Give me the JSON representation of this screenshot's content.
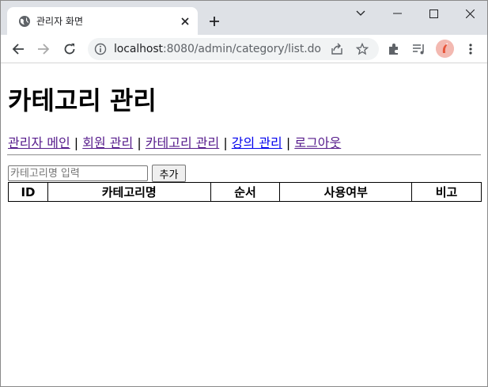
{
  "browser": {
    "tab_title": "관리자 화면",
    "url_host": "localhost",
    "url_rest": ":8080/admin/category/list.do"
  },
  "page": {
    "title": "카테고리 관리",
    "nav": [
      {
        "label": "관리자 메인"
      },
      {
        "label": "회원 관리"
      },
      {
        "label": "카테고리 관리"
      },
      {
        "label": "강의 관리"
      },
      {
        "label": "로그아웃"
      }
    ],
    "nav_separator": "|",
    "form": {
      "input_placeholder": "카테고리명 입력",
      "input_value": "",
      "add_button": "추가"
    },
    "table": {
      "columns": [
        "ID",
        "카테고리명",
        "순서",
        "사용여부",
        "비고"
      ],
      "rows": []
    }
  }
}
